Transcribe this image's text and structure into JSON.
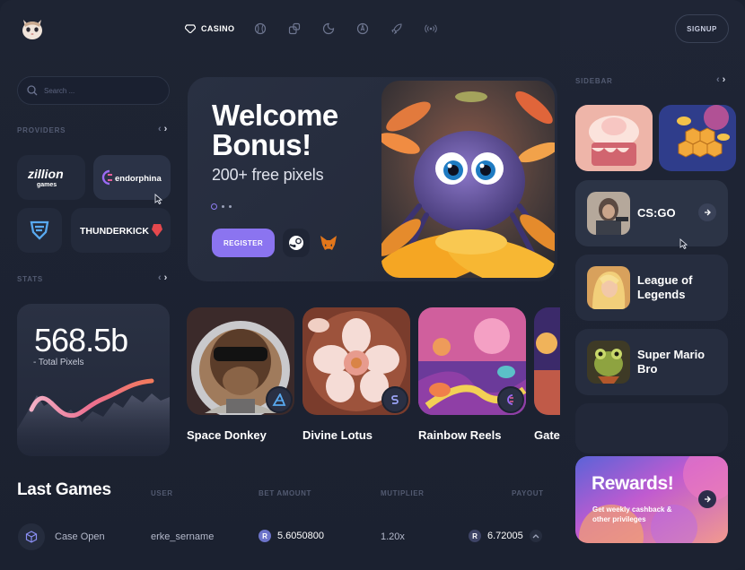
{
  "nav": {
    "casino_label": "CASINO",
    "icons": [
      "baseball-icon",
      "dice-icon",
      "moon-icon",
      "compass-icon",
      "rocket-icon",
      "radio-icon"
    ],
    "signup_label": "SIGNUP"
  },
  "search": {
    "placeholder": "Search ..."
  },
  "providers": {
    "label": "PROVIDERS",
    "items": [
      "zillion games",
      "endorphina",
      "thunderkick"
    ]
  },
  "stats": {
    "label": "STATS",
    "value": "568.5b",
    "caption": "- Total Pixels"
  },
  "hero": {
    "title": "Welcome Bonus!",
    "subtitle": "200+ free pixels",
    "register_label": "REGISTER",
    "slide_count": 3,
    "active_slide": 1
  },
  "games": [
    {
      "title": "Space Donkey"
    },
    {
      "title": "Divine Lotus"
    },
    {
      "title": "Rainbow Reels"
    },
    {
      "title": "Gates of Olympus"
    }
  ],
  "last_games": {
    "title": "Last Games",
    "columns": [
      "USER",
      "BET AMOUNT",
      "MUTIPLIER",
      "PAYOUT"
    ],
    "rows": [
      {
        "game": "Case Open",
        "user": "erke_sername",
        "bet": "5.6050800",
        "multiplier": "1.20x",
        "payout": "6.72005"
      }
    ]
  },
  "sidebar": {
    "label": "SIDEBAR",
    "items": [
      {
        "title": "CS:GO"
      },
      {
        "title": "League of Legends"
      },
      {
        "title": "Super Mario Bro"
      }
    ],
    "rewards": {
      "title": "Rewards!",
      "subtitle": "Get weekly cashback & other privileges"
    }
  },
  "colors": {
    "background": "#1b2130",
    "card": "#262d3f",
    "accent": "#8b74f0"
  }
}
